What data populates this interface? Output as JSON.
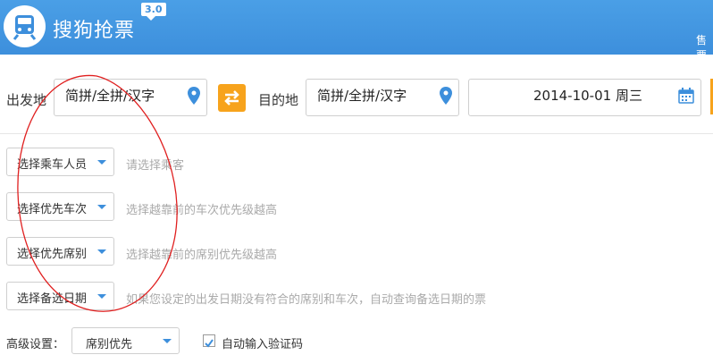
{
  "header": {
    "app_title": "搜狗抢票",
    "version": "3.0",
    "right_text": "售票"
  },
  "route": {
    "from_label": "出发地",
    "from_placeholder": "简拼/全拼/汉字",
    "to_label": "目的地",
    "to_placeholder": "简拼/全拼/汉字",
    "date_value": "2014-10-01  周三"
  },
  "options": [
    {
      "select_label": "选择乘车人员",
      "hint": "请选择乘客"
    },
    {
      "select_label": "选择优先车次",
      "hint": "选择越靠前的车次优先级越高"
    },
    {
      "select_label": "选择优先席别",
      "hint": "选择越靠前的席别优先级越高"
    },
    {
      "select_label": "选择备选日期",
      "hint": "如果您设定的出发日期没有符合的席别和车次，自动查询备选日期的票"
    }
  ],
  "advanced": {
    "label": "高级设置：",
    "select_value": "席别优先",
    "auto_captcha_label": "自动输入验证码",
    "auto_captcha_checked": true
  },
  "colors": {
    "header_blue": "#3d8fdc",
    "accent_orange": "#f7a31c",
    "annotation_red": "#e02020"
  }
}
